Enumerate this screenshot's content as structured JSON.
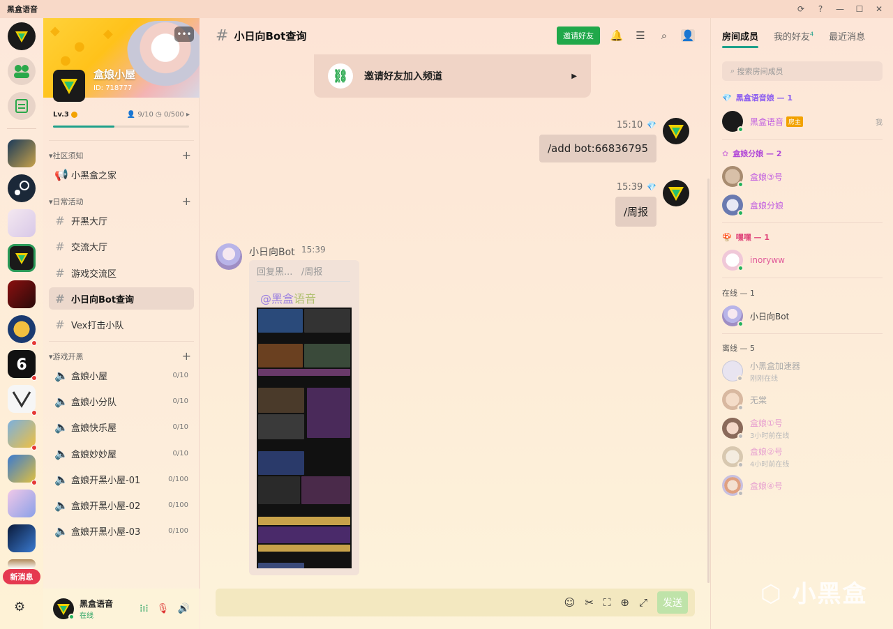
{
  "app": {
    "title": "黑盒语音"
  },
  "window_controls": [
    "⟳",
    "?",
    "—",
    "☐",
    "✕"
  ],
  "rail": {
    "new_message_label": "新消息"
  },
  "server": {
    "name": "盒娘小屋",
    "id_label": "ID: 718777",
    "level": "Lv.3",
    "members": "9/10",
    "coins": "0/500",
    "level_progress": 0.45
  },
  "categories": [
    {
      "label": "▾社区须知"
    },
    {
      "label": "▾日常活动"
    },
    {
      "label": "▾游戏开黑"
    }
  ],
  "channels": {
    "notice": [
      {
        "label": "小黑盒之家",
        "icon": "megaphone"
      }
    ],
    "daily": [
      {
        "label": "开黑大厅"
      },
      {
        "label": "交流大厅"
      },
      {
        "label": "游戏交流区"
      },
      {
        "label": "小日向Bot查询"
      },
      {
        "label": "Vex打击小队"
      }
    ],
    "voice": [
      {
        "label": "盒娘小屋",
        "count": "0/10"
      },
      {
        "label": "盒娘小分队",
        "count": "0/10"
      },
      {
        "label": "盒娘快乐屋",
        "count": "0/10"
      },
      {
        "label": "盒娘妙妙屋",
        "count": "0/10"
      },
      {
        "label": "盒娘开黑小屋-01",
        "count": "0/100"
      },
      {
        "label": "盒娘开黑小屋-02",
        "count": "0/100"
      },
      {
        "label": "盒娘开黑小屋-03",
        "count": "0/100"
      }
    ]
  },
  "user": {
    "name": "黑盒语音",
    "status": "在线"
  },
  "chat": {
    "channel_title": "小日向Bot查询",
    "invite_button": "邀请好友",
    "invite_card": "邀请好友加入频道",
    "messages": [
      {
        "time": "15:10",
        "text": "/add bot:66836795"
      },
      {
        "time": "15:39",
        "text": "/周报"
      }
    ],
    "bot": {
      "name": "小日向Bot",
      "time": "15:39",
      "reply_prefix": "回复黑...",
      "reply_text": "/周报",
      "mention_at": "@黑盒",
      "mention_rest": "语音"
    },
    "send_label": "发送"
  },
  "right": {
    "tabs": [
      "房间成员",
      "我的好友",
      "最近消息"
    ],
    "friends_badge": "4",
    "search_placeholder": "搜索房间成员",
    "groups": [
      {
        "label": "黑盒语音娘 — 1",
        "color": "#8a5cf0"
      },
      {
        "label": "盒娘分娘 — 2",
        "color": "#b24ad8"
      },
      {
        "label": "嘿嘿 — 1",
        "color": "#e0457a"
      },
      {
        "label": "在线 — 1",
        "color": "#555555"
      },
      {
        "label": "离线 — 5",
        "color": "#555555"
      }
    ],
    "members": [
      {
        "name": "黑盒语音",
        "tag": "房主",
        "me": "我",
        "color": "#c05ce0"
      },
      {
        "name": "盒娘③号",
        "color": "#c05ce0"
      },
      {
        "name": "盒娘分娘",
        "color": "#c05ce0"
      },
      {
        "name": "inoryww",
        "color": "#e05a9a"
      },
      {
        "name": "小日向Bot",
        "color": "#444444"
      },
      {
        "name": "小黑盒加速器",
        "sub": "刚刚在线",
        "color": "#aaaaaa"
      },
      {
        "name": "无棠",
        "color": "#aaaaaa"
      },
      {
        "name": "盒娘①号",
        "sub": "3小时前在线",
        "color": "#e7a0d0"
      },
      {
        "name": "盒娘②号",
        "sub": "4小时前在线",
        "color": "#e7a0d0"
      },
      {
        "name": "盒娘④号",
        "color": "#e7a0d0"
      }
    ]
  },
  "watermark": "小黑盒"
}
